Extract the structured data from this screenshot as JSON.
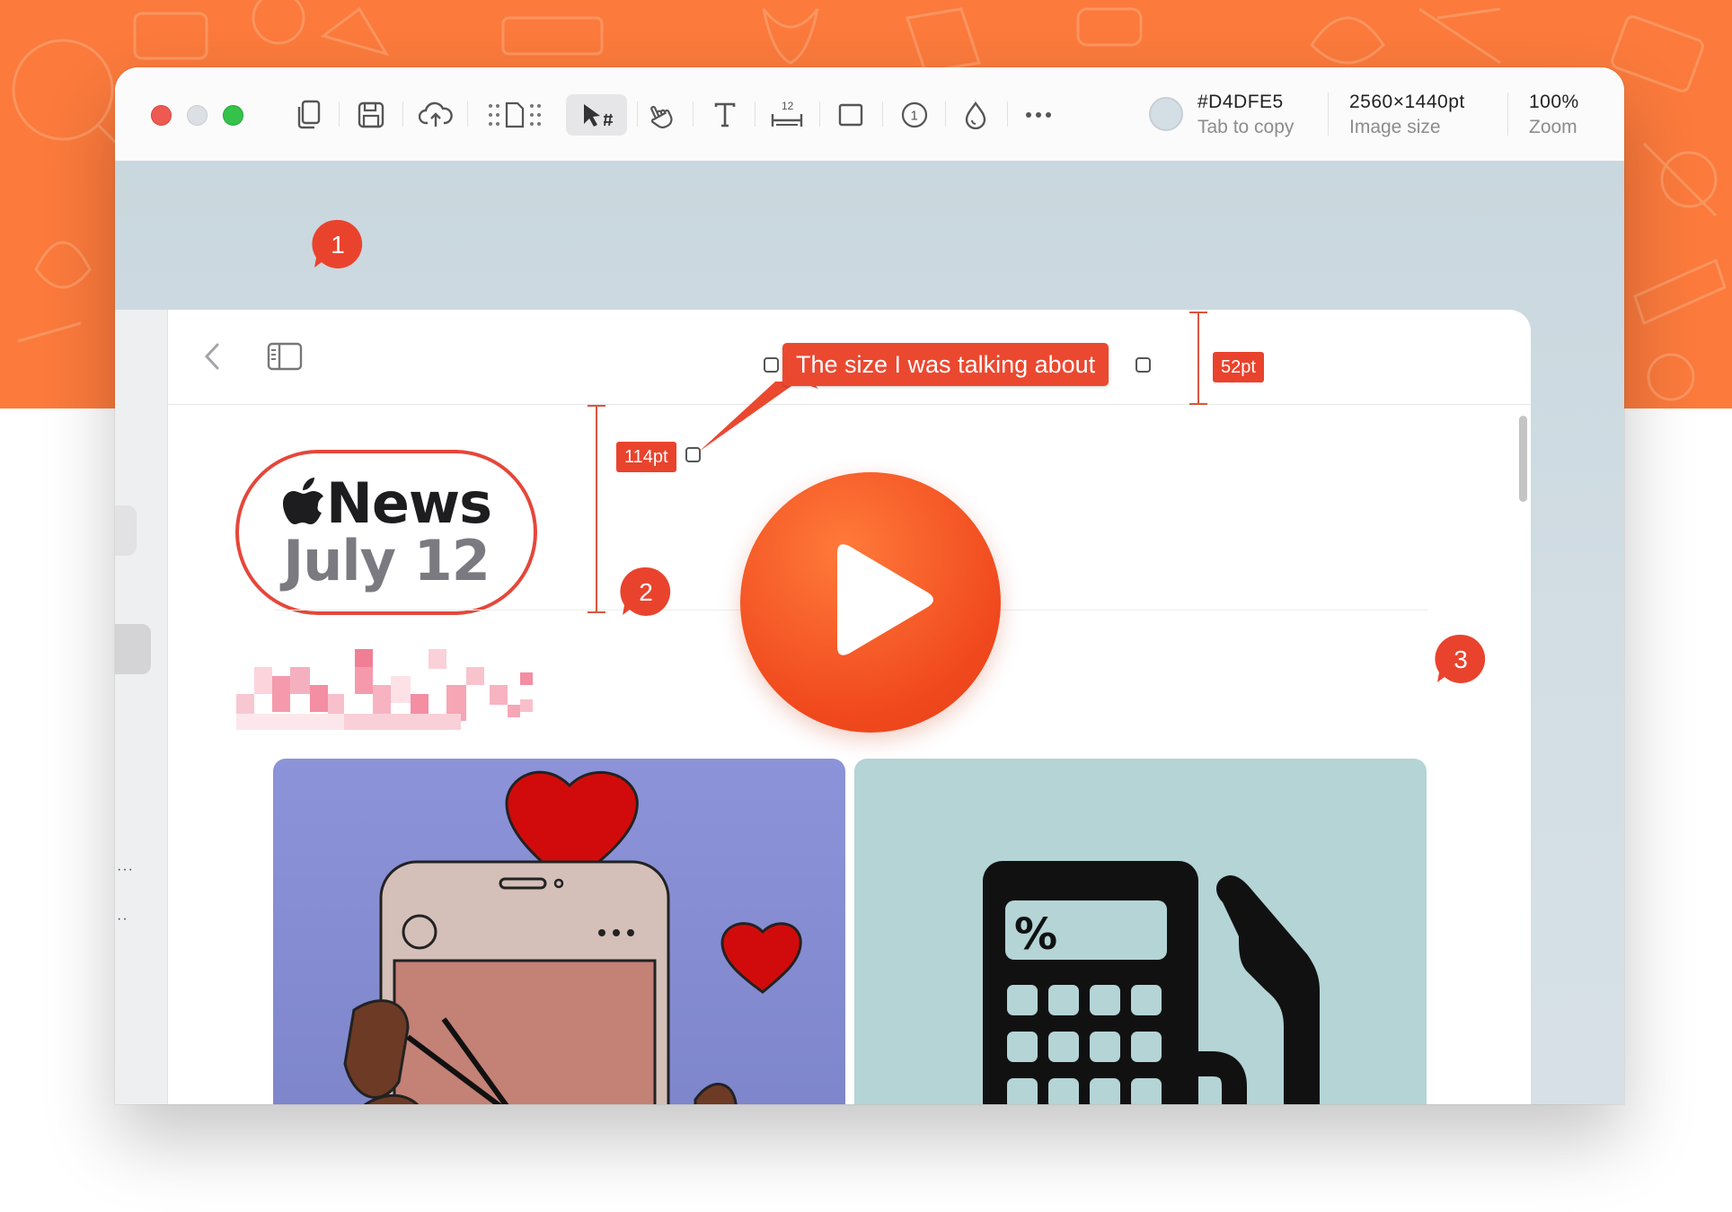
{
  "window": {
    "traffic_lights": [
      "close",
      "minimize",
      "zoom"
    ]
  },
  "toolbar": {
    "tools": [
      {
        "name": "copy-icon"
      },
      {
        "name": "save-icon"
      },
      {
        "name": "cloud-upload-icon"
      },
      {
        "name": "crop-icon"
      },
      {
        "name": "arrow-select-icon",
        "active": true
      },
      {
        "name": "hand-icon"
      },
      {
        "name": "text-icon"
      },
      {
        "name": "measure-icon",
        "label": "12"
      },
      {
        "name": "rectangle-icon"
      },
      {
        "name": "counter-icon",
        "label": "1"
      },
      {
        "name": "drop-icon"
      },
      {
        "name": "more-icon"
      }
    ],
    "color_value": "#D4DFE5",
    "color_label": "Tab to copy",
    "image_size_value": "2560×1440pt",
    "image_size_label": "Image size",
    "zoom_value": "100%",
    "zoom_label": "Zoom",
    "swatch_color": "#D4DFE5"
  },
  "annotations": {
    "callout_text": "The size I was talking about",
    "measure_height_label": "114pt",
    "measure_toolbar_label": "52pt",
    "markers": [
      "1",
      "2",
      "3"
    ]
  },
  "content": {
    "news_brand": "News",
    "news_date": "July 12"
  },
  "colors": {
    "accent": "#EB4830",
    "background_orange": "#FB7A3C",
    "canvas": "#D4DFE5"
  }
}
